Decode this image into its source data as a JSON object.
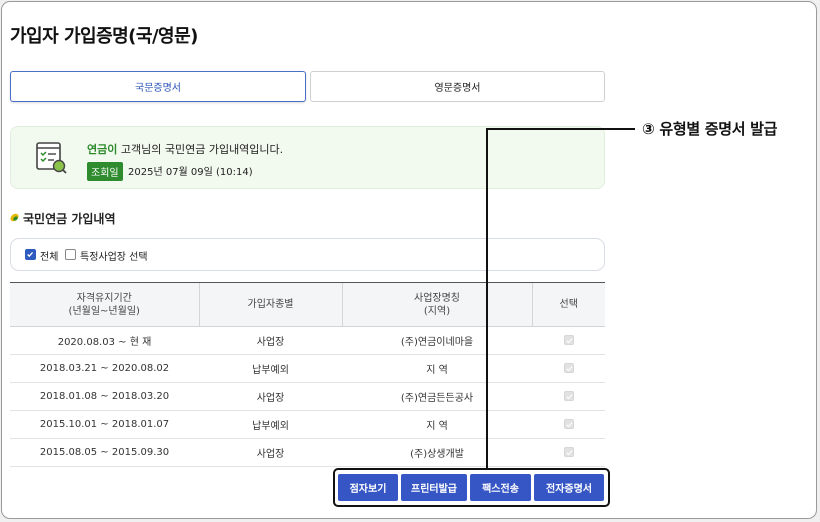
{
  "page": {
    "title": "가입자 가입증명(국/영문)"
  },
  "tabs": [
    {
      "label": "국문증명서",
      "active": true
    },
    {
      "label": "영문증명서",
      "active": false
    }
  ],
  "info": {
    "user_name": "연금이",
    "message": " 고객님의 국민연금 가입내역입니다.",
    "query_badge": "조회일",
    "query_date": "2025년 07월 09일 (10:14)",
    "icon": "document-check-icon"
  },
  "section": {
    "title": "국민연금 가입내역",
    "icon": "leaf-icon"
  },
  "filters": {
    "all_label": "전체",
    "all_checked": true,
    "specific_label": "특정사업장 선택",
    "specific_checked": false
  },
  "table": {
    "headers": {
      "period_line1": "자격유지기간",
      "period_line2": "(년월일~년월일)",
      "type": "가입자종별",
      "workplace_line1": "사업장명칭",
      "workplace_line2": "(지역)",
      "select": "선택"
    },
    "rows": [
      {
        "period": "2020.08.03 ~ 현 재",
        "type": "사업장",
        "workplace": "(주)연금이네마을",
        "selected": true
      },
      {
        "period": "2018.03.21 ~ 2020.08.02",
        "type": "납부예외",
        "workplace": "지 역",
        "selected": true
      },
      {
        "period": "2018.01.08 ~ 2018.03.20",
        "type": "사업장",
        "workplace": "(주)연금든든공사",
        "selected": true
      },
      {
        "period": "2015.10.01 ~ 2018.01.07",
        "type": "납부예외",
        "workplace": "지 역",
        "selected": true
      },
      {
        "period": "2015.08.05 ~ 2015.09.30",
        "type": "사업장",
        "workplace": "(주)상생개발",
        "selected": true
      }
    ]
  },
  "actions": {
    "braille": "점자보기",
    "print": "프린터발급",
    "fax": "팩스전송",
    "electronic": "전자증명서"
  },
  "annotation": {
    "label": "③ 유형별 증명서 발급"
  },
  "colors": {
    "primary": "#3556c4",
    "green": "#2e8b2e",
    "info_bg": "#f2f9ee"
  }
}
